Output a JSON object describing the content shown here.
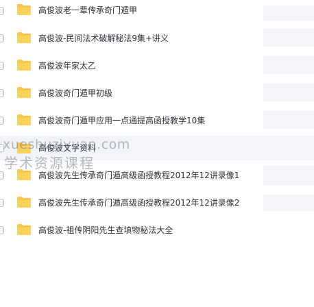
{
  "folder_color": "#f7c64a",
  "folder_icon": "folder-icon",
  "files": [
    {
      "name": "高俊波老一辈传承奇门遁甲"
    },
    {
      "name": "高俊波-民间法术破解秘法9集+讲义"
    },
    {
      "name": "高俊波年家太乙"
    },
    {
      "name": "高俊波奇门遁甲初级"
    },
    {
      "name": "高俊波奇门遁甲应用一点通提高函授教学10集"
    },
    {
      "name": "高俊波文字资料"
    },
    {
      "name": "高俊波先生传承奇门遁高级函授教程2012年12讲录像1"
    },
    {
      "name": "高俊波先生传承奇门遁高级函授教程2012年12讲录像2"
    },
    {
      "name": "高俊波-祖传阴阳先生查填物秘法大全"
    }
  ],
  "watermark": {
    "url": "xueshuziyuan.com",
    "text": "学术资源课程"
  }
}
